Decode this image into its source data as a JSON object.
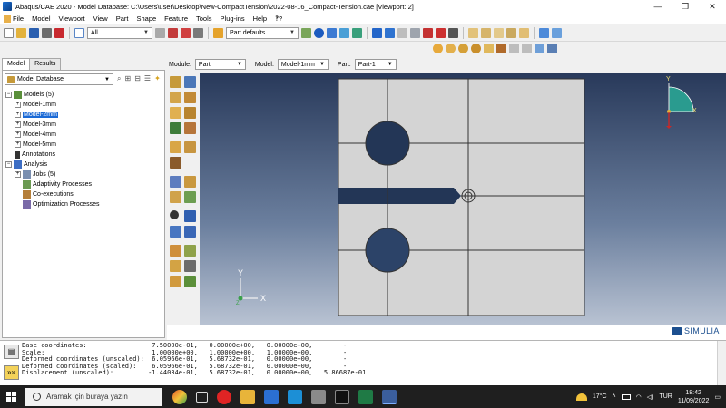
{
  "window": {
    "title": "Abaqus/CAE 2020 - Model Database: C:\\Users\\user\\Desktop\\New-CompactTension\\2022-08-16_Compact-Tension.cae [Viewport: 2]",
    "minimize": "—",
    "maximize": "❐",
    "close": "✕"
  },
  "menubar": {
    "items": [
      "File",
      "Model",
      "Viewport",
      "View",
      "Part",
      "Shape",
      "Feature",
      "Tools",
      "Plug-ins",
      "Help",
      "‽?"
    ]
  },
  "toolbar": {
    "selection_filter": "All",
    "render_style": "Part defaults"
  },
  "left_panel": {
    "tabs": [
      "Model",
      "Results"
    ],
    "database_select": "Model Database",
    "tree": {
      "models_label": "Models (5)",
      "models": [
        "Model-1mm",
        "Model-2mm",
        "Model-3mm",
        "Model-4mm",
        "Model-5mm"
      ],
      "selected_model": "Model-2mm",
      "annotations": "Annotations",
      "analysis": "Analysis",
      "jobs": "Jobs (5)",
      "adaptivity": "Adaptivity Processes",
      "coexecutions": "Co-executions",
      "optimization": "Optimization Processes"
    }
  },
  "module_bar": {
    "module_label": "Module:",
    "module_value": "Part",
    "model_label": "Model:",
    "model_value": "Model-1mm",
    "part_label": "Part:",
    "part_value": "Part-1"
  },
  "viewport": {
    "axis_y": "Y",
    "axis_x": "X",
    "axis_z": "Z",
    "view_y": "Y",
    "view_x": "X",
    "brand": "SIMULIA",
    "colors": {
      "part_fill": "#d4d4d4",
      "hole_fill": "#233656",
      "edge": "#333333"
    }
  },
  "message_area": {
    "lines": [
      "Base coordinates:                 7.50000e-01,   0.00000e+00,   0.00000e+00,        -",
      "Scale:                            1.00000e+00,   1.00000e+00,   1.00000e+00,        -",
      "Deformed coordinates (unscaled):  6.05966e-01,   5.68732e-01,   0.00000e+00,        -",
      "Deformed coordinates (scaled):    6.05966e-01,   5.68732e-01,   0.00000e+00,        -",
      "Displacement (unscaled):         -1.44034e-01,   5.68732e-01,   0.00000e+00,   5.86687e-01"
    ],
    "prompt_icon": "»»"
  },
  "taskbar": {
    "search_placeholder": "Aramak için buraya yazın",
    "weather": "17°C",
    "language": "TUR",
    "time": "18:42",
    "date": "11/09/2022"
  }
}
